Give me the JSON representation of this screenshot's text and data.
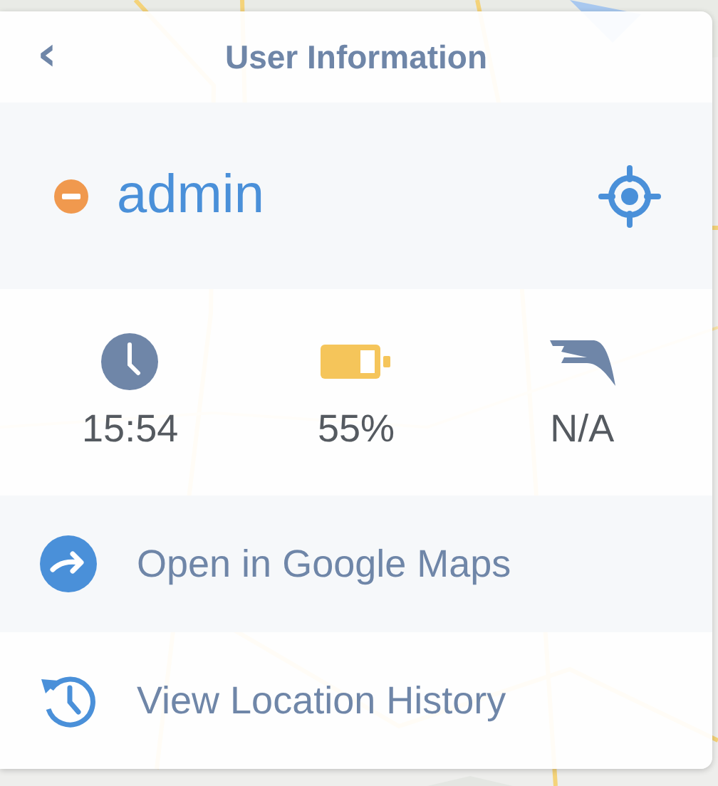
{
  "header": {
    "back": "‹",
    "title": "User Information"
  },
  "user": {
    "name": "admin"
  },
  "stats": [
    {
      "kind": "clock",
      "value": "15:54"
    },
    {
      "kind": "battery",
      "value": "55%"
    },
    {
      "kind": "speed",
      "value": "N/A"
    }
  ],
  "actions": [
    {
      "kind": "open-maps",
      "label": "Open in Google Maps"
    },
    {
      "kind": "history",
      "label": "View Location History"
    }
  ]
}
